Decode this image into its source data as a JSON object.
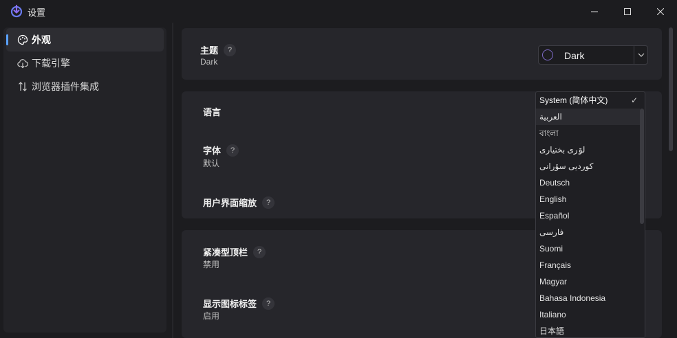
{
  "window": {
    "title": "设置"
  },
  "sidebar": {
    "items": [
      {
        "label": "外观",
        "icon": "palette-icon",
        "active": true
      },
      {
        "label": "下载引擎",
        "icon": "cloud-download-icon",
        "active": false
      },
      {
        "label": "浏览器插件集成",
        "icon": "swap-vertical-icon",
        "active": false
      }
    ]
  },
  "appearance": {
    "theme": {
      "label": "主题",
      "help": "?",
      "value": "Dark",
      "select_value": "Dark"
    },
    "language": {
      "label": "语言"
    },
    "font": {
      "label": "字体",
      "help": "?",
      "value": "默认"
    },
    "ui_scale": {
      "label": "用户界面缩放",
      "help": "?"
    },
    "compact_titlebar": {
      "label": "紧凑型顶栏",
      "help": "?",
      "value": "禁用"
    },
    "icon_labels": {
      "label": "显示图标标签",
      "help": "?",
      "value": "启用"
    }
  },
  "language_menu": {
    "selected": "System (简体中文)",
    "check_glyph": "✓",
    "options": [
      "System (简体中文)",
      "العربية",
      "বাংলা",
      "لۊری بختیاری",
      "کوردیی سۆرانی",
      "Deutsch",
      "English",
      "Español",
      "فارسی",
      "Suomi",
      "Français",
      "Magyar",
      "Bahasa Indonesia",
      "Italiano",
      "日本語"
    ]
  },
  "colors": {
    "accent": "#5aa2ff",
    "theme_circle": "#7e6bc9",
    "background": "#1c1c1f",
    "card": "#26262b"
  }
}
